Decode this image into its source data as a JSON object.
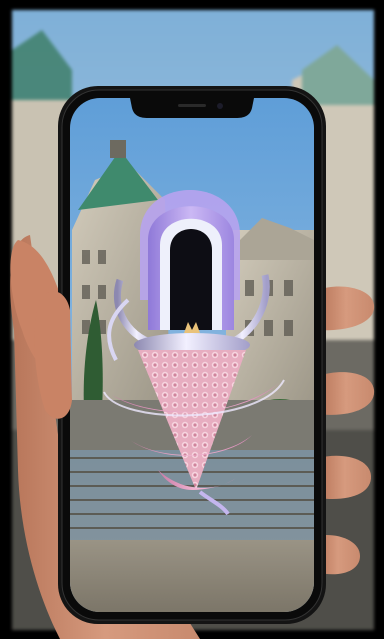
{
  "scene": {
    "subject": "hand-holding-smartphone",
    "screen_content": "ar-sculpture-over-building-plaza",
    "colors": {
      "sky": "#6fa6d6",
      "roof": "#3f8a6d",
      "stone": "#b8b2a2",
      "sculpture_lavender": "#b9a3ec",
      "sculpture_pink": "#e7a1c6",
      "chrome": "#c9c6e6",
      "phone_frame": "#151515",
      "skin": "#c9876a"
    }
  }
}
